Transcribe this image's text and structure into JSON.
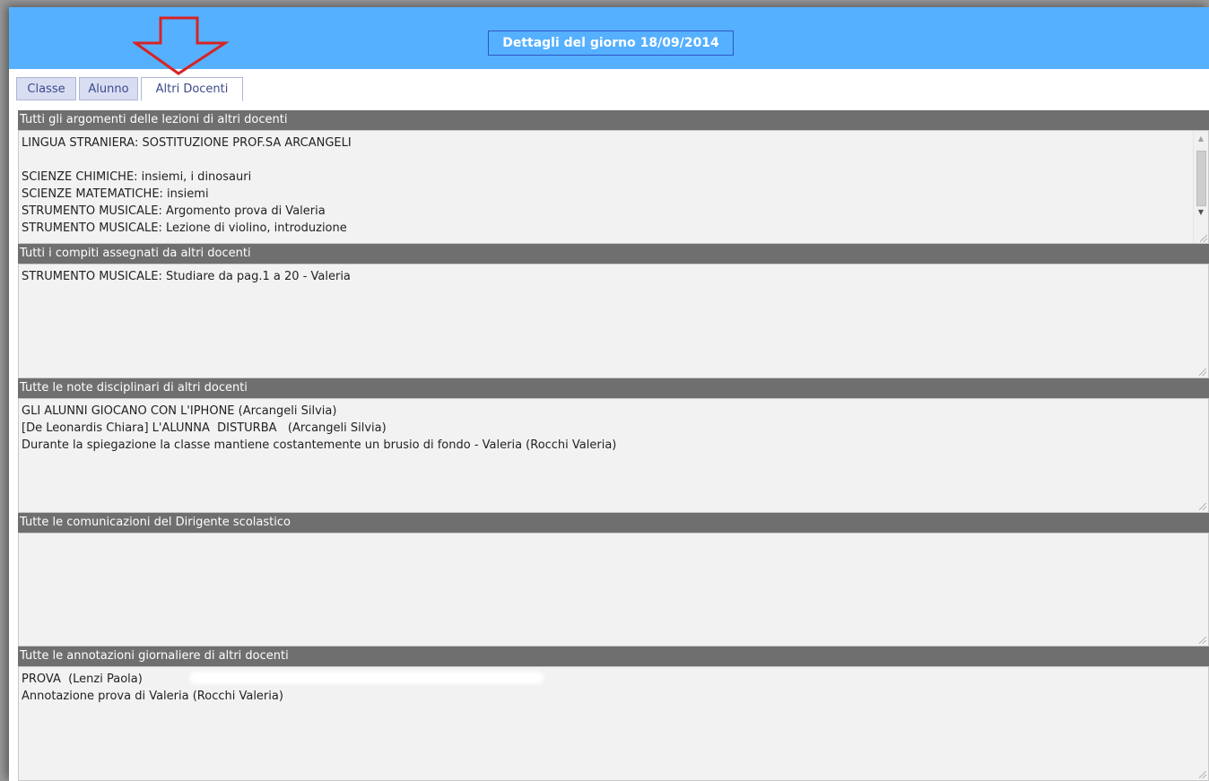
{
  "header": {
    "title": "Dettagli del giorno 18/09/2014"
  },
  "tabs": [
    {
      "label": "Classe"
    },
    {
      "label": "Alunno"
    },
    {
      "label": "Altri Docenti"
    }
  ],
  "sections": [
    {
      "title": "Tutti gli argomenti delle lezioni di altri docenti",
      "lines": [
        "LINGUA STRANIERA: SOSTITUZIONE PROF.SA ARCANGELI",
        "",
        "SCIENZE CHIMICHE: insiemi, i dinosauri",
        "SCIENZE MATEMATICHE: insiemi",
        "STRUMENTO MUSICALE: Argomento prova di Valeria",
        "STRUMENTO MUSICALE: Lezione di violino, introduzione"
      ]
    },
    {
      "title": "Tutti i compiti assegnati da altri docenti",
      "lines": [
        "STRUMENTO MUSICALE: Studiare da pag.1 a 20 - Valeria"
      ]
    },
    {
      "title": "Tutte le note disciplinari di altri docenti",
      "lines": [
        "GLI ALUNNI GIOCANO CON L'IPHONE (Arcangeli Silvia)",
        "[De Leonardis Chiara] L'ALUNNA  DISTURBA   (Arcangeli Silvia)",
        "Durante la spiegazione la classe mantiene costantemente un brusio di fondo - Valeria (Rocchi Valeria)"
      ]
    },
    {
      "title": "Tutte le comunicazioni del Dirigente scolastico",
      "lines": []
    },
    {
      "title": "Tutte le annotazioni giornaliere di altri docenti",
      "lines": [
        "PROVA  (Lenzi Paola)",
        "Annotazione prova di Valeria (Rocchi Valeria)"
      ]
    }
  ]
}
